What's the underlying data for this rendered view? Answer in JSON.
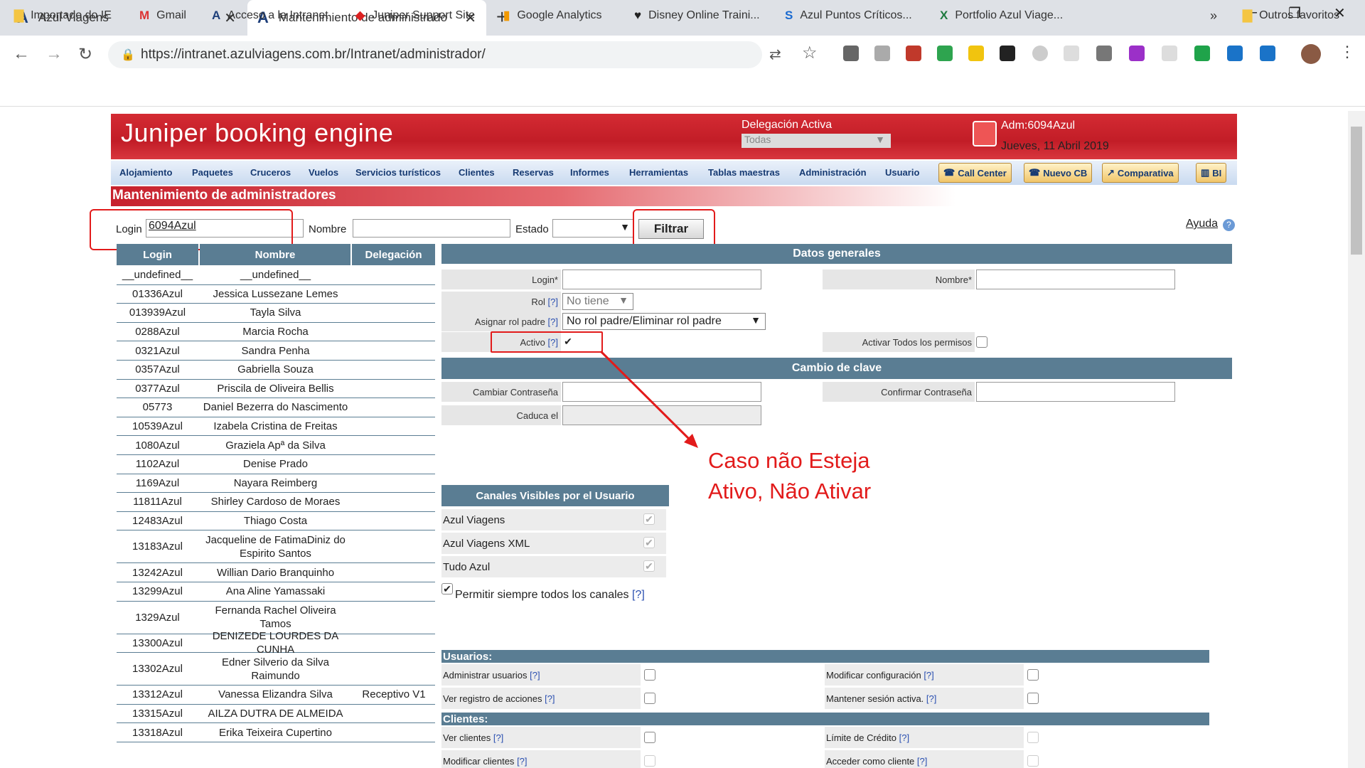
{
  "browser": {
    "tabs": [
      {
        "title": "Azul Viagens"
      },
      {
        "title": "Mantenimiento de administrado"
      }
    ],
    "url": "https://intranet.azulviagens.com.br/Intranet/administrador/",
    "bookmarks": [
      "Importado do IE",
      "Gmail",
      "Acceso a la Intranet",
      "Juniper Support Site",
      "Google Analytics",
      "Disney Online Traini...",
      "Azul Puntos Críticos...",
      "Portfolio Azul Viage..."
    ],
    "other_favorites": "Outros favoritos"
  },
  "app": {
    "title": "Juniper booking engine",
    "delegacion_label": "Delegación Activa",
    "delegacion_value": "Todas",
    "user": "Adm:6094Azul",
    "date": "Jueves, 11 Abril 2019",
    "menu": [
      "Alojamiento",
      "Paquetes",
      "Cruceros",
      "Vuelos",
      "Servicios turísticos",
      "Clientes",
      "Reservas",
      "Informes",
      "Herramientas",
      "Tablas maestras",
      "Administración",
      "Usuario"
    ],
    "menu_buttons": [
      "Call Center",
      "Nuevo CB",
      "Comparativa",
      "BI"
    ],
    "section_title": "Mantenimiento de administradores"
  },
  "filter": {
    "login_label": "Login",
    "login_value": "6094Azul",
    "nombre_label": "Nombre",
    "estado_label": "Estado",
    "filtrar": "Filtrar",
    "ayuda": "Ayuda"
  },
  "list": {
    "headers": [
      "Login",
      "Nombre",
      "Delegación"
    ],
    "rows": [
      [
        "__undefined__",
        "__undefined__",
        ""
      ],
      [
        "01336Azul",
        "Jessica Lussezane Lemes",
        ""
      ],
      [
        "013939Azul",
        "Tayla Silva",
        ""
      ],
      [
        "0288Azul",
        "Marcia Rocha",
        ""
      ],
      [
        "0321Azul",
        "Sandra Penha",
        ""
      ],
      [
        "0357Azul",
        "Gabriella Souza",
        ""
      ],
      [
        "0377Azul",
        "Priscila de Oliveira Bellis",
        ""
      ],
      [
        "05773",
        "Daniel Bezerra do Nascimento",
        ""
      ],
      [
        "10539Azul",
        "Izabela Cristina de Freitas",
        ""
      ],
      [
        "1080Azul",
        "Graziela Apª da Silva",
        ""
      ],
      [
        "1102Azul",
        "Denise Prado",
        ""
      ],
      [
        "1169Azul",
        "Nayara Reimberg",
        ""
      ],
      [
        "11811Azul",
        "Shirley Cardoso de Moraes",
        ""
      ],
      [
        "12483Azul",
        "Thiago Costa",
        ""
      ],
      [
        "13183Azul",
        "Jacqueline de FatimaDiniz do Espirito Santos",
        ""
      ],
      [
        "13242Azul",
        "Willian Dario Branquinho",
        ""
      ],
      [
        "13299Azul",
        "Ana Aline Yamassaki",
        ""
      ],
      [
        "1329Azul",
        "Fernanda Rachel Oliveira Tamos",
        ""
      ],
      [
        "13300Azul",
        "DENIZEDE LOURDES DA CUNHA",
        ""
      ],
      [
        "13302Azul",
        "Edner Silverio da Silva Raimundo",
        ""
      ],
      [
        "13312Azul",
        "Vanessa Elizandra Silva",
        "Receptivo V1"
      ],
      [
        "13315Azul",
        "AILZA DUTRA DE ALMEIDA",
        ""
      ],
      [
        "13318Azul",
        "Erika Teixeira Cupertino",
        ""
      ]
    ]
  },
  "form": {
    "datos_generales": "Datos generales",
    "login_label": "Login*",
    "nombre_label": "Nombre*",
    "rol_label": "Rol",
    "rol_value": "No tiene",
    "asignar_label": "Asignar rol padre",
    "asignar_value": "No rol padre/Eliminar rol padre",
    "activo_label": "Activo",
    "activar_todos_label": "Activar Todos los permisos",
    "help": "[?]",
    "cambio_clave": "Cambio de clave",
    "cambiar_label": "Cambiar Contraseña",
    "confirmar_label": "Confirmar Contraseña",
    "caduca_label": "Caduca el",
    "canales_title": "Canales Visibles por el Usuario",
    "canales": [
      "Azul Viagens",
      "Azul Viagens XML",
      "Tudo Azul"
    ],
    "permitir": "Permitir siempre todos los canales",
    "usuarios_title": "Usuarios:",
    "usuarios": [
      "Administrar usuarios",
      "Ver registro de acciones"
    ],
    "usuarios_right": [
      "Modificar configuración",
      "Mantener sesión activa."
    ],
    "clientes_title": "Clientes:",
    "clientes": [
      "Ver clientes",
      "Modificar clientes"
    ],
    "clientes_right": [
      "Límite de Crédito",
      "Acceder como cliente"
    ]
  },
  "annotation": {
    "line1": "Caso não Esteja",
    "line2": "Ativo, Não Ativar",
    "color": "#e21b1b"
  }
}
